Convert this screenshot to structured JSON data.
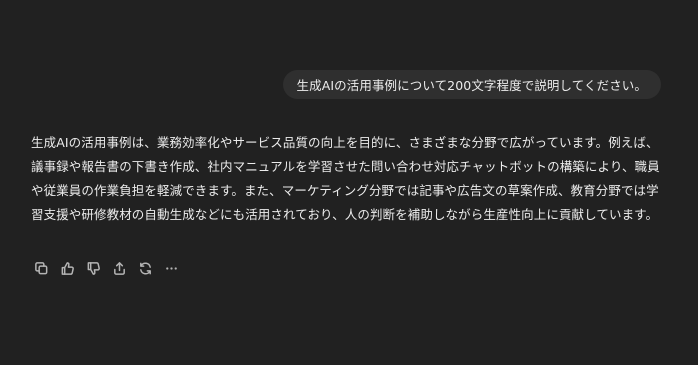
{
  "conversation": {
    "user_message": "生成AIの活用事例について200文字程度で説明してください。",
    "assistant_message": "生成AIの活用事例は、業務効率化やサービス品質の向上を目的に、さまざまな分野で広がっています。例えば、議事録や報告書の下書き作成、社内マニュアルを学習させた問い合わせ対応チャットボットの構築により、職員や従業員の作業負担を軽減できます。また、マーケティング分野では記事や広告文の草案作成、教育分野では学習支援や研修教材の自動生成などにも活用されており、人の判断を補助しながら生産性向上に貢献しています。"
  },
  "message_actions": [
    {
      "icon": "copy-icon"
    },
    {
      "icon": "thumbs-up-icon"
    },
    {
      "icon": "thumbs-down-icon"
    },
    {
      "icon": "share-icon"
    },
    {
      "icon": "regenerate-icon"
    },
    {
      "icon": "more-options-icon"
    }
  ],
  "colors": {
    "background": "#212121",
    "user_bubble": "#2f2f2f",
    "text": "#ececec",
    "icon": "#b4b4b4"
  }
}
